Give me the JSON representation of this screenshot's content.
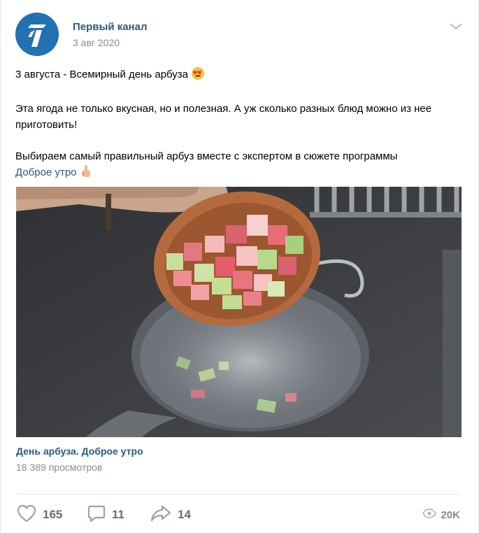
{
  "post": {
    "author": "Первый канал",
    "date": "3 авг 2020",
    "text": {
      "line1": "3 августа - Всемирный день арбуза",
      "line2": "Эта ягода не только вкусная, но и полезная. А уж сколько разных блюд можно из нее приготовить!",
      "line3": "Выбираем самый правильный арбуз вместе с экспертом в сюжете программы",
      "hashtag": "Доброе утро"
    },
    "video": {
      "title": "День арбуза. Доброе утро",
      "views": "18 389 просмотров"
    },
    "actions": {
      "likes": "165",
      "comments": "11",
      "shares": "14",
      "views": "20K"
    },
    "icons": [
      "channel-one-logo",
      "chevron-down-icon",
      "heart-eyes-emoji-icon",
      "pointing-finger-icon",
      "like-icon",
      "comment-icon",
      "share-icon",
      "eye-icon"
    ],
    "colors": {
      "link": "#2a5885",
      "muted": "#818c99",
      "action": "#656d78",
      "logo": "#2271b3"
    }
  }
}
